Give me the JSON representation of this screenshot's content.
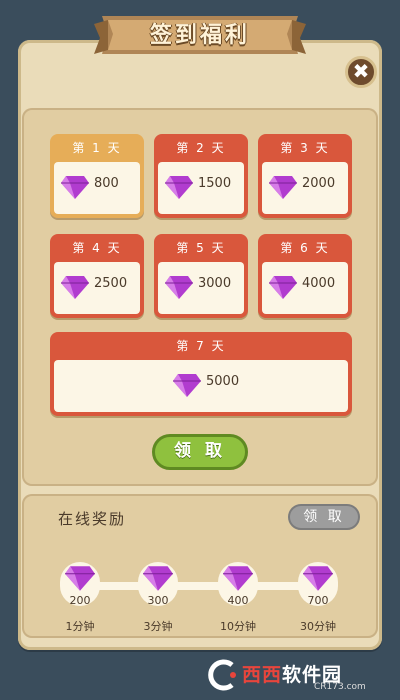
{
  "title": "签到福利",
  "close_label": "✖",
  "days": [
    {
      "label": "第 1 天",
      "amount": "800",
      "state": "claimable"
    },
    {
      "label": "第 2 天",
      "amount": "1500",
      "state": "locked"
    },
    {
      "label": "第 3 天",
      "amount": "2000",
      "state": "locked"
    },
    {
      "label": "第 4 天",
      "amount": "2500",
      "state": "locked"
    },
    {
      "label": "第 5 天",
      "amount": "3000",
      "state": "locked"
    },
    {
      "label": "第 6 天",
      "amount": "4000",
      "state": "locked"
    },
    {
      "label": "第 7 天",
      "amount": "5000",
      "state": "locked"
    }
  ],
  "claim_label": "领 取",
  "online": {
    "title": "在线奖励",
    "claim_label": "领 取",
    "rewards": [
      {
        "amount": "200",
        "time": "1分钟"
      },
      {
        "amount": "300",
        "time": "3分钟"
      },
      {
        "amount": "400",
        "time": "10分钟"
      },
      {
        "amount": "700",
        "time": "30分钟"
      }
    ]
  },
  "watermark": {
    "name_a": "西西",
    "name_b": "软件园",
    "url": "CR173.com"
  },
  "colors": {
    "active_header": "#e6ad58",
    "locked_header": "#d9573c",
    "claim_button": "#8fc13e",
    "disabled_button": "#9d9d9d",
    "gem": "#b13ccf"
  },
  "icons": [
    "gem-icon",
    "close-icon",
    "watermark-logo-icon"
  ]
}
